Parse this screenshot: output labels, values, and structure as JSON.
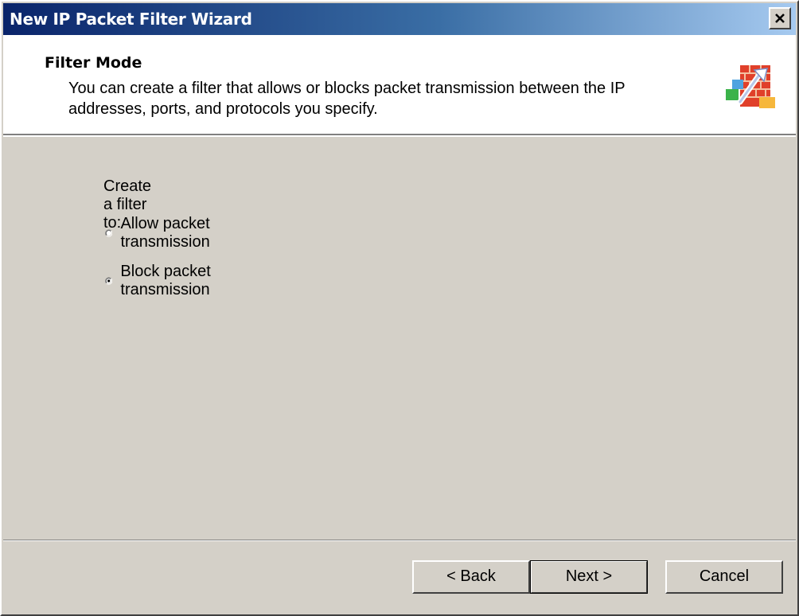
{
  "window": {
    "title": "New IP Packet Filter Wizard"
  },
  "header": {
    "title": "Filter Mode",
    "description": "You can create a filter that allows or blocks packet transmission between the IP addresses, ports, and protocols you specify.",
    "icon": "firewall-icon"
  },
  "main": {
    "prompt": "Create a filter to:",
    "options": [
      {
        "label": "Allow packet transmission",
        "selected": false
      },
      {
        "label": "Block packet transmission",
        "selected": true
      }
    ]
  },
  "buttons": {
    "back": "< Back",
    "next": "Next >",
    "cancel": "Cancel"
  },
  "colors": {
    "titlebar_start": "#0a246a",
    "titlebar_end": "#a6caf0",
    "face": "#d4d0c8"
  }
}
